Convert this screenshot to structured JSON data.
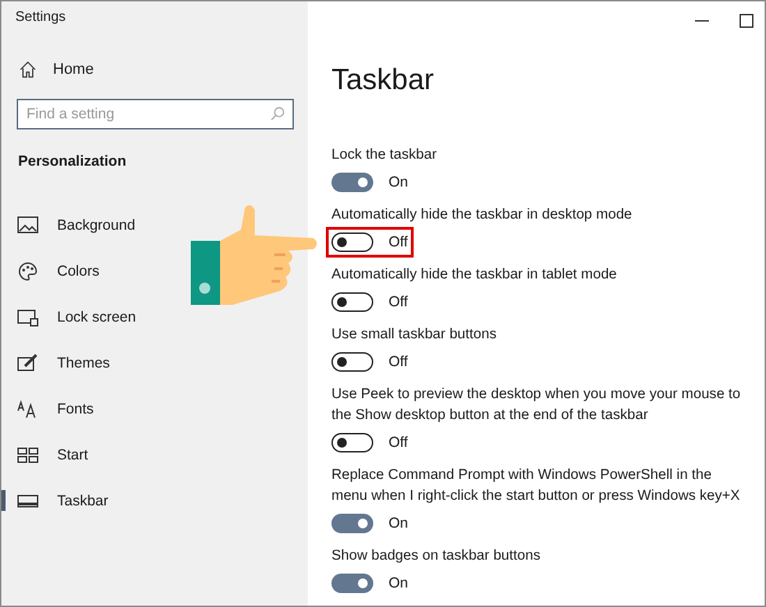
{
  "window": {
    "title": "Settings"
  },
  "sidebar": {
    "home": "Home",
    "search": {
      "placeholder": "Find a setting"
    },
    "section": "Personalization",
    "items": [
      {
        "label": "Background",
        "selected": false
      },
      {
        "label": "Colors",
        "selected": false
      },
      {
        "label": "Lock screen",
        "selected": false
      },
      {
        "label": "Themes",
        "selected": false
      },
      {
        "label": "Fonts",
        "selected": false
      },
      {
        "label": "Start",
        "selected": false
      },
      {
        "label": "Taskbar",
        "selected": true
      }
    ]
  },
  "page": {
    "title": "Taskbar",
    "settings": [
      {
        "label": "Lock the taskbar",
        "on": true,
        "state": "On",
        "highlighted": false
      },
      {
        "label": "Automatically hide the taskbar in desktop mode",
        "on": false,
        "state": "Off",
        "highlighted": true
      },
      {
        "label": "Automatically hide the taskbar in tablet mode",
        "on": false,
        "state": "Off",
        "highlighted": false
      },
      {
        "label": "Use small taskbar buttons",
        "on": false,
        "state": "Off",
        "highlighted": false
      },
      {
        "label": "Use Peek to preview the desktop when you move your mouse to the Show desktop button at the end of the taskbar",
        "on": false,
        "state": "Off",
        "highlighted": false
      },
      {
        "label": "Replace Command Prompt with Windows PowerShell in the menu when I right-click the start button or press Windows key+X",
        "on": true,
        "state": "On",
        "highlighted": false
      },
      {
        "label": "Show badges on taskbar buttons",
        "on": true,
        "state": "On",
        "highlighted": false
      }
    ]
  }
}
